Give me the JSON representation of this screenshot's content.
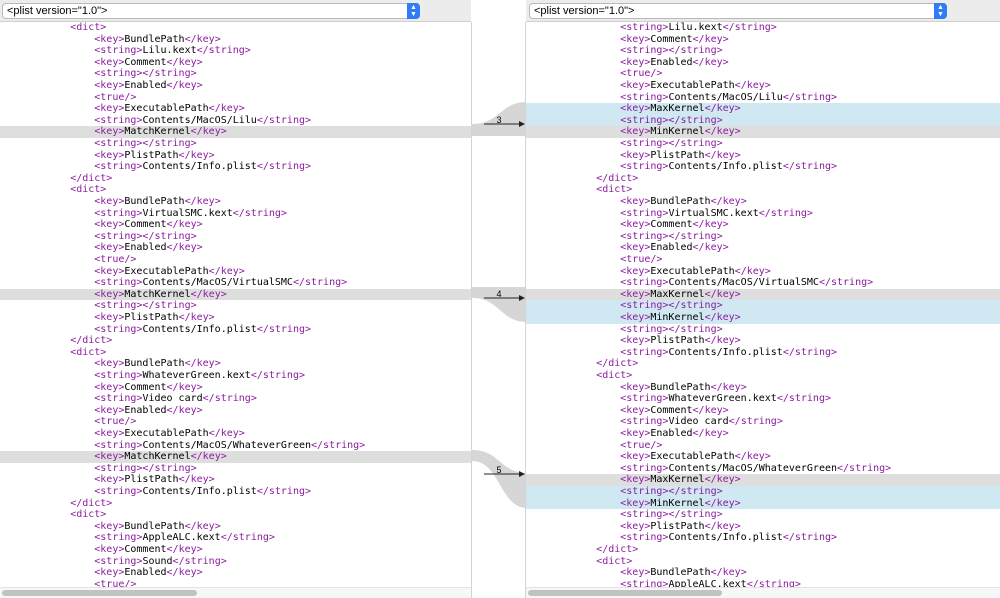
{
  "left_header": {
    "select_value": "<plist version=\"1.0\">"
  },
  "right_header": {
    "select_value": "<plist version=\"1.0\">"
  },
  "diff_markers": [
    "3",
    "4",
    "5"
  ],
  "left_lines": [
    {
      "indent": 5,
      "parts": [
        [
          "t",
          "<dict>"
        ]
      ]
    },
    {
      "indent": 7,
      "parts": [
        [
          "t",
          "<key>"
        ],
        [
          "v",
          "BundlePath"
        ],
        [
          "t",
          "</key>"
        ]
      ]
    },
    {
      "indent": 7,
      "parts": [
        [
          "t",
          "<string>"
        ],
        [
          "v",
          "Lilu.kext"
        ],
        [
          "t",
          "</string>"
        ]
      ]
    },
    {
      "indent": 7,
      "parts": [
        [
          "t",
          "<key>"
        ],
        [
          "v",
          "Comment"
        ],
        [
          "t",
          "</key>"
        ]
      ]
    },
    {
      "indent": 7,
      "parts": [
        [
          "t",
          "<string></string>"
        ]
      ]
    },
    {
      "indent": 7,
      "parts": [
        [
          "t",
          "<key>"
        ],
        [
          "v",
          "Enabled"
        ],
        [
          "t",
          "</key>"
        ]
      ]
    },
    {
      "indent": 7,
      "parts": [
        [
          "t",
          "<true/>"
        ]
      ]
    },
    {
      "indent": 7,
      "parts": [
        [
          "t",
          "<key>"
        ],
        [
          "v",
          "ExecutablePath"
        ],
        [
          "t",
          "</key>"
        ]
      ]
    },
    {
      "indent": 7,
      "parts": [
        [
          "t",
          "<string>"
        ],
        [
          "v",
          "Contents/MacOS/Lilu"
        ],
        [
          "t",
          "</string>"
        ]
      ]
    },
    {
      "indent": 7,
      "hl": "gray",
      "parts": [
        [
          "t",
          "<key>"
        ],
        [
          "v",
          "MatchKernel"
        ],
        [
          "t",
          "</key>"
        ]
      ]
    },
    {
      "indent": 7,
      "parts": [
        [
          "t",
          "<string></string>"
        ]
      ]
    },
    {
      "indent": 7,
      "parts": [
        [
          "t",
          "<key>"
        ],
        [
          "v",
          "PlistPath"
        ],
        [
          "t",
          "</key>"
        ]
      ]
    },
    {
      "indent": 7,
      "parts": [
        [
          "t",
          "<string>"
        ],
        [
          "v",
          "Contents/Info.plist"
        ],
        [
          "t",
          "</string>"
        ]
      ]
    },
    {
      "indent": 5,
      "parts": [
        [
          "t",
          "</dict>"
        ]
      ]
    },
    {
      "indent": 5,
      "parts": [
        [
          "t",
          "<dict>"
        ]
      ]
    },
    {
      "indent": 7,
      "parts": [
        [
          "t",
          "<key>"
        ],
        [
          "v",
          "BundlePath"
        ],
        [
          "t",
          "</key>"
        ]
      ]
    },
    {
      "indent": 7,
      "parts": [
        [
          "t",
          "<string>"
        ],
        [
          "v",
          "VirtualSMC.kext"
        ],
        [
          "t",
          "</string>"
        ]
      ]
    },
    {
      "indent": 7,
      "parts": [
        [
          "t",
          "<key>"
        ],
        [
          "v",
          "Comment"
        ],
        [
          "t",
          "</key>"
        ]
      ]
    },
    {
      "indent": 7,
      "parts": [
        [
          "t",
          "<string></string>"
        ]
      ]
    },
    {
      "indent": 7,
      "parts": [
        [
          "t",
          "<key>"
        ],
        [
          "v",
          "Enabled"
        ],
        [
          "t",
          "</key>"
        ]
      ]
    },
    {
      "indent": 7,
      "parts": [
        [
          "t",
          "<true/>"
        ]
      ]
    },
    {
      "indent": 7,
      "parts": [
        [
          "t",
          "<key>"
        ],
        [
          "v",
          "ExecutablePath"
        ],
        [
          "t",
          "</key>"
        ]
      ]
    },
    {
      "indent": 7,
      "parts": [
        [
          "t",
          "<string>"
        ],
        [
          "v",
          "Contents/MacOS/VirtualSMC"
        ],
        [
          "t",
          "</string>"
        ]
      ]
    },
    {
      "indent": 7,
      "hl": "gray",
      "parts": [
        [
          "t",
          "<key>"
        ],
        [
          "v",
          "MatchKernel"
        ],
        [
          "t",
          "</key>"
        ]
      ]
    },
    {
      "indent": 7,
      "parts": [
        [
          "t",
          "<string></string>"
        ]
      ]
    },
    {
      "indent": 7,
      "parts": [
        [
          "t",
          "<key>"
        ],
        [
          "v",
          "PlistPath"
        ],
        [
          "t",
          "</key>"
        ]
      ]
    },
    {
      "indent": 7,
      "parts": [
        [
          "t",
          "<string>"
        ],
        [
          "v",
          "Contents/Info.plist"
        ],
        [
          "t",
          "</string>"
        ]
      ]
    },
    {
      "indent": 5,
      "parts": [
        [
          "t",
          "</dict>"
        ]
      ]
    },
    {
      "indent": 5,
      "parts": [
        [
          "t",
          "<dict>"
        ]
      ]
    },
    {
      "indent": 7,
      "parts": [
        [
          "t",
          "<key>"
        ],
        [
          "v",
          "BundlePath"
        ],
        [
          "t",
          "</key>"
        ]
      ]
    },
    {
      "indent": 7,
      "parts": [
        [
          "t",
          "<string>"
        ],
        [
          "v",
          "WhateverGreen.kext"
        ],
        [
          "t",
          "</string>"
        ]
      ]
    },
    {
      "indent": 7,
      "parts": [
        [
          "t",
          "<key>"
        ],
        [
          "v",
          "Comment"
        ],
        [
          "t",
          "</key>"
        ]
      ]
    },
    {
      "indent": 7,
      "parts": [
        [
          "t",
          "<string>"
        ],
        [
          "v",
          "Video card"
        ],
        [
          "t",
          "</string>"
        ]
      ]
    },
    {
      "indent": 7,
      "parts": [
        [
          "t",
          "<key>"
        ],
        [
          "v",
          "Enabled"
        ],
        [
          "t",
          "</key>"
        ]
      ]
    },
    {
      "indent": 7,
      "parts": [
        [
          "t",
          "<true/>"
        ]
      ]
    },
    {
      "indent": 7,
      "parts": [
        [
          "t",
          "<key>"
        ],
        [
          "v",
          "ExecutablePath"
        ],
        [
          "t",
          "</key>"
        ]
      ]
    },
    {
      "indent": 7,
      "parts": [
        [
          "t",
          "<string>"
        ],
        [
          "v",
          "Contents/MacOS/WhateverGreen"
        ],
        [
          "t",
          "</string>"
        ]
      ]
    },
    {
      "indent": 7,
      "hl": "gray",
      "parts": [
        [
          "t",
          "<key>"
        ],
        [
          "v",
          "MatchKernel"
        ],
        [
          "t",
          "</key>"
        ]
      ]
    },
    {
      "indent": 7,
      "parts": [
        [
          "t",
          "<string></string>"
        ]
      ]
    },
    {
      "indent": 7,
      "parts": [
        [
          "t",
          "<key>"
        ],
        [
          "v",
          "PlistPath"
        ],
        [
          "t",
          "</key>"
        ]
      ]
    },
    {
      "indent": 7,
      "parts": [
        [
          "t",
          "<string>"
        ],
        [
          "v",
          "Contents/Info.plist"
        ],
        [
          "t",
          "</string>"
        ]
      ]
    },
    {
      "indent": 5,
      "parts": [
        [
          "t",
          "</dict>"
        ]
      ]
    },
    {
      "indent": 5,
      "parts": [
        [
          "t",
          "<dict>"
        ]
      ]
    },
    {
      "indent": 7,
      "parts": [
        [
          "t",
          "<key>"
        ],
        [
          "v",
          "BundlePath"
        ],
        [
          "t",
          "</key>"
        ]
      ]
    },
    {
      "indent": 7,
      "parts": [
        [
          "t",
          "<string>"
        ],
        [
          "v",
          "AppleALC.kext"
        ],
        [
          "t",
          "</string>"
        ]
      ]
    },
    {
      "indent": 7,
      "parts": [
        [
          "t",
          "<key>"
        ],
        [
          "v",
          "Comment"
        ],
        [
          "t",
          "</key>"
        ]
      ]
    },
    {
      "indent": 7,
      "parts": [
        [
          "t",
          "<string>"
        ],
        [
          "v",
          "Sound"
        ],
        [
          "t",
          "</string>"
        ]
      ]
    },
    {
      "indent": 7,
      "parts": [
        [
          "t",
          "<key>"
        ],
        [
          "v",
          "Enabled"
        ],
        [
          "t",
          "</key>"
        ]
      ]
    },
    {
      "indent": 7,
      "parts": [
        [
          "t",
          "<true/>"
        ]
      ]
    }
  ],
  "right_lines": [
    {
      "indent": 7,
      "parts": [
        [
          "t",
          "<string>"
        ],
        [
          "v",
          "Lilu.kext"
        ],
        [
          "t",
          "</string>"
        ]
      ]
    },
    {
      "indent": 7,
      "parts": [
        [
          "t",
          "<key>"
        ],
        [
          "v",
          "Comment"
        ],
        [
          "t",
          "</key>"
        ]
      ]
    },
    {
      "indent": 7,
      "parts": [
        [
          "t",
          "<string></string>"
        ]
      ]
    },
    {
      "indent": 7,
      "parts": [
        [
          "t",
          "<key>"
        ],
        [
          "v",
          "Enabled"
        ],
        [
          "t",
          "</key>"
        ]
      ]
    },
    {
      "indent": 7,
      "parts": [
        [
          "t",
          "<true/>"
        ]
      ]
    },
    {
      "indent": 7,
      "parts": [
        [
          "t",
          "<key>"
        ],
        [
          "v",
          "ExecutablePath"
        ],
        [
          "t",
          "</key>"
        ]
      ]
    },
    {
      "indent": 7,
      "parts": [
        [
          "t",
          "<string>"
        ],
        [
          "v",
          "Contents/MacOS/Lilu"
        ],
        [
          "t",
          "</string>"
        ]
      ]
    },
    {
      "indent": 7,
      "hl": "blue",
      "parts": [
        [
          "t",
          "<key>"
        ],
        [
          "v",
          "MaxKernel"
        ],
        [
          "t",
          "</key>"
        ]
      ]
    },
    {
      "indent": 7,
      "hl": "blue",
      "parts": [
        [
          "t",
          "<string></string>"
        ]
      ]
    },
    {
      "indent": 7,
      "hl": "gray",
      "parts": [
        [
          "t",
          "<key>"
        ],
        [
          "v",
          "MinKernel"
        ],
        [
          "t",
          "</key>"
        ]
      ]
    },
    {
      "indent": 7,
      "parts": [
        [
          "t",
          "<string></string>"
        ]
      ]
    },
    {
      "indent": 7,
      "parts": [
        [
          "t",
          "<key>"
        ],
        [
          "v",
          "PlistPath"
        ],
        [
          "t",
          "</key>"
        ]
      ]
    },
    {
      "indent": 7,
      "parts": [
        [
          "t",
          "<string>"
        ],
        [
          "v",
          "Contents/Info.plist"
        ],
        [
          "t",
          "</string>"
        ]
      ]
    },
    {
      "indent": 5,
      "parts": [
        [
          "t",
          "</dict>"
        ]
      ]
    },
    {
      "indent": 5,
      "parts": [
        [
          "t",
          "<dict>"
        ]
      ]
    },
    {
      "indent": 7,
      "parts": [
        [
          "t",
          "<key>"
        ],
        [
          "v",
          "BundlePath"
        ],
        [
          "t",
          "</key>"
        ]
      ]
    },
    {
      "indent": 7,
      "parts": [
        [
          "t",
          "<string>"
        ],
        [
          "v",
          "VirtualSMC.kext"
        ],
        [
          "t",
          "</string>"
        ]
      ]
    },
    {
      "indent": 7,
      "parts": [
        [
          "t",
          "<key>"
        ],
        [
          "v",
          "Comment"
        ],
        [
          "t",
          "</key>"
        ]
      ]
    },
    {
      "indent": 7,
      "parts": [
        [
          "t",
          "<string></string>"
        ]
      ]
    },
    {
      "indent": 7,
      "parts": [
        [
          "t",
          "<key>"
        ],
        [
          "v",
          "Enabled"
        ],
        [
          "t",
          "</key>"
        ]
      ]
    },
    {
      "indent": 7,
      "parts": [
        [
          "t",
          "<true/>"
        ]
      ]
    },
    {
      "indent": 7,
      "parts": [
        [
          "t",
          "<key>"
        ],
        [
          "v",
          "ExecutablePath"
        ],
        [
          "t",
          "</key>"
        ]
      ]
    },
    {
      "indent": 7,
      "parts": [
        [
          "t",
          "<string>"
        ],
        [
          "v",
          "Contents/MacOS/VirtualSMC"
        ],
        [
          "t",
          "</string>"
        ]
      ]
    },
    {
      "indent": 7,
      "hl": "gray",
      "parts": [
        [
          "t",
          "<key>"
        ],
        [
          "v",
          "MaxKernel"
        ],
        [
          "t",
          "</key>"
        ]
      ]
    },
    {
      "indent": 7,
      "hl": "blue",
      "parts": [
        [
          "t",
          "<string></string>"
        ]
      ]
    },
    {
      "indent": 7,
      "hl": "blue",
      "parts": [
        [
          "t",
          "<key>"
        ],
        [
          "v",
          "MinKernel"
        ],
        [
          "t",
          "</key>"
        ]
      ]
    },
    {
      "indent": 7,
      "parts": [
        [
          "t",
          "<string></string>"
        ]
      ]
    },
    {
      "indent": 7,
      "parts": [
        [
          "t",
          "<key>"
        ],
        [
          "v",
          "PlistPath"
        ],
        [
          "t",
          "</key>"
        ]
      ]
    },
    {
      "indent": 7,
      "parts": [
        [
          "t",
          "<string>"
        ],
        [
          "v",
          "Contents/Info.plist"
        ],
        [
          "t",
          "</string>"
        ]
      ]
    },
    {
      "indent": 5,
      "parts": [
        [
          "t",
          "</dict>"
        ]
      ]
    },
    {
      "indent": 5,
      "parts": [
        [
          "t",
          "<dict>"
        ]
      ]
    },
    {
      "indent": 7,
      "parts": [
        [
          "t",
          "<key>"
        ],
        [
          "v",
          "BundlePath"
        ],
        [
          "t",
          "</key>"
        ]
      ]
    },
    {
      "indent": 7,
      "parts": [
        [
          "t",
          "<string>"
        ],
        [
          "v",
          "WhateverGreen.kext"
        ],
        [
          "t",
          "</string>"
        ]
      ]
    },
    {
      "indent": 7,
      "parts": [
        [
          "t",
          "<key>"
        ],
        [
          "v",
          "Comment"
        ],
        [
          "t",
          "</key>"
        ]
      ]
    },
    {
      "indent": 7,
      "parts": [
        [
          "t",
          "<string>"
        ],
        [
          "v",
          "Video card"
        ],
        [
          "t",
          "</string>"
        ]
      ]
    },
    {
      "indent": 7,
      "parts": [
        [
          "t",
          "<key>"
        ],
        [
          "v",
          "Enabled"
        ],
        [
          "t",
          "</key>"
        ]
      ]
    },
    {
      "indent": 7,
      "parts": [
        [
          "t",
          "<true/>"
        ]
      ]
    },
    {
      "indent": 7,
      "parts": [
        [
          "t",
          "<key>"
        ],
        [
          "v",
          "ExecutablePath"
        ],
        [
          "t",
          "</key>"
        ]
      ]
    },
    {
      "indent": 7,
      "parts": [
        [
          "t",
          "<string>"
        ],
        [
          "v",
          "Contents/MacOS/WhateverGreen"
        ],
        [
          "t",
          "</string>"
        ]
      ]
    },
    {
      "indent": 7,
      "hl": "gray",
      "parts": [
        [
          "t",
          "<key>"
        ],
        [
          "v",
          "MaxKernel"
        ],
        [
          "t",
          "</key>"
        ]
      ]
    },
    {
      "indent": 7,
      "hl": "blue",
      "parts": [
        [
          "t",
          "<string></string>"
        ]
      ]
    },
    {
      "indent": 7,
      "hl": "blue",
      "parts": [
        [
          "t",
          "<key>"
        ],
        [
          "v",
          "MinKernel"
        ],
        [
          "t",
          "</key>"
        ]
      ]
    },
    {
      "indent": 7,
      "parts": [
        [
          "t",
          "<string></string>"
        ]
      ]
    },
    {
      "indent": 7,
      "parts": [
        [
          "t",
          "<key>"
        ],
        [
          "v",
          "PlistPath"
        ],
        [
          "t",
          "</key>"
        ]
      ]
    },
    {
      "indent": 7,
      "parts": [
        [
          "t",
          "<string>"
        ],
        [
          "v",
          "Contents/Info.plist"
        ],
        [
          "t",
          "</string>"
        ]
      ]
    },
    {
      "indent": 5,
      "parts": [
        [
          "t",
          "</dict>"
        ]
      ]
    },
    {
      "indent": 5,
      "parts": [
        [
          "t",
          "<dict>"
        ]
      ]
    },
    {
      "indent": 7,
      "parts": [
        [
          "t",
          "<key>"
        ],
        [
          "v",
          "BundlePath"
        ],
        [
          "t",
          "</key>"
        ]
      ]
    },
    {
      "indent": 7,
      "parts": [
        [
          "t",
          "<string>"
        ],
        [
          "v",
          "AppleALC.kext"
        ],
        [
          "t",
          "</string>"
        ]
      ]
    }
  ]
}
